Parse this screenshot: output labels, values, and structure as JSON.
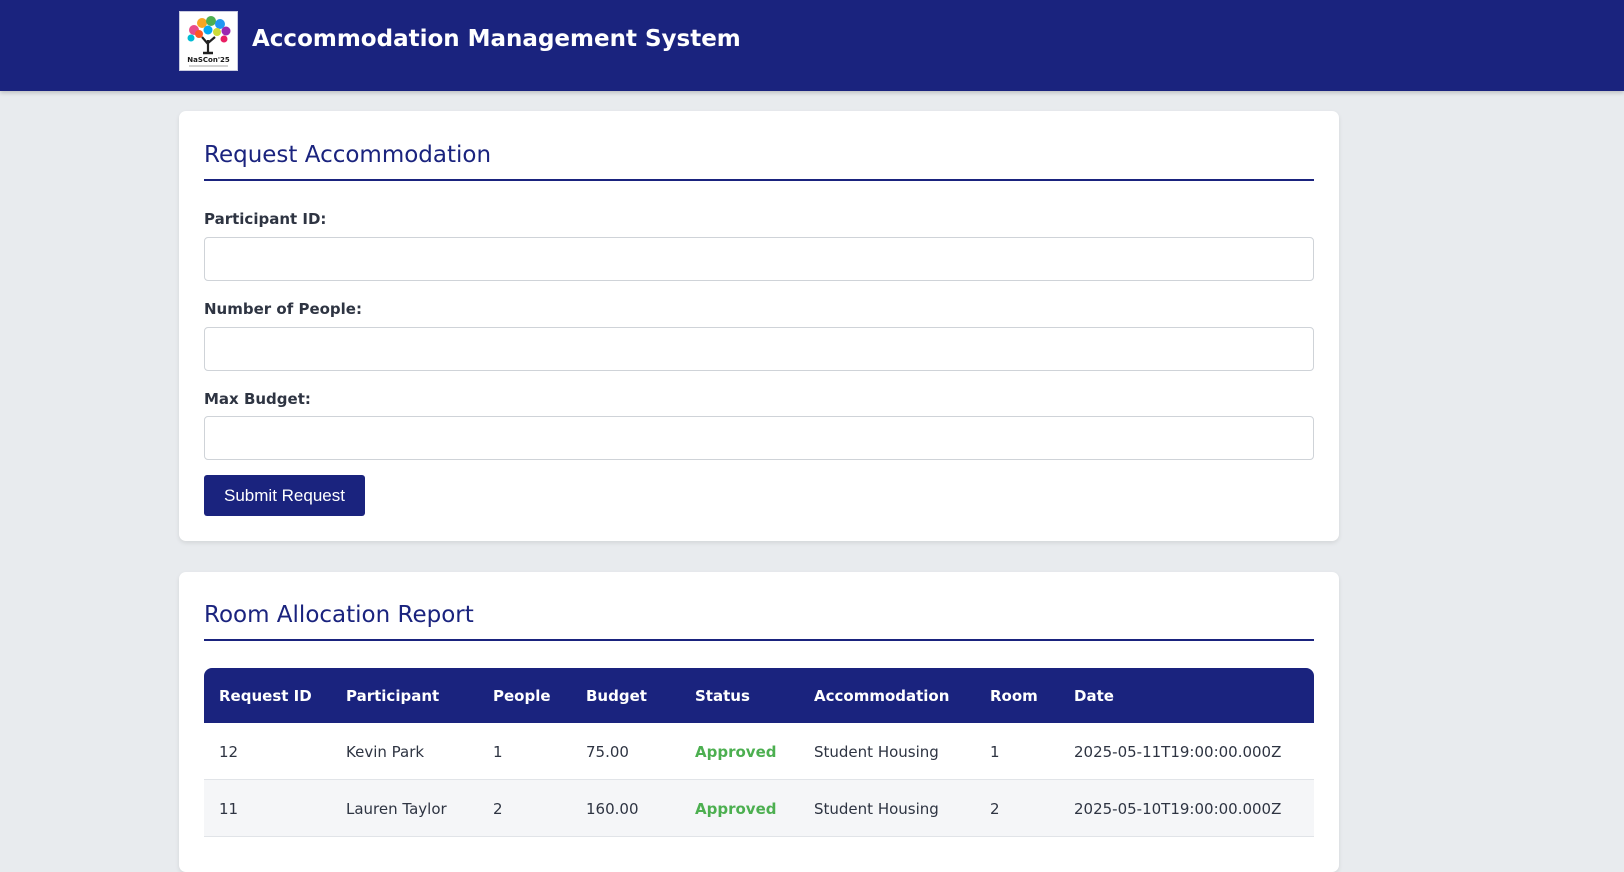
{
  "header": {
    "title": "Accommodation Management System",
    "logo_icon": "tree-logo-icon"
  },
  "request_form": {
    "title": "Request Accommodation",
    "fields": [
      {
        "label": "Participant ID:",
        "value": "",
        "placeholder": ""
      },
      {
        "label": "Number of People:",
        "value": "",
        "placeholder": ""
      },
      {
        "label": "Max Budget:",
        "value": "",
        "placeholder": ""
      }
    ],
    "submit_label": "Submit Request"
  },
  "report": {
    "title": "Room Allocation Report",
    "columns": [
      "Request ID",
      "Participant",
      "People",
      "Budget",
      "Status",
      "Accommodation",
      "Room",
      "Date"
    ],
    "rows": [
      [
        "12",
        "Kevin Park",
        "1",
        "75.00",
        "Approved",
        "Student Housing",
        "1",
        "2025-05-11T19:00:00.000Z"
      ],
      [
        "11",
        "Lauren Taylor",
        "2",
        "160.00",
        "Approved",
        "Student Housing",
        "2",
        "2025-05-10T19:00:00.000Z"
      ]
    ]
  },
  "colors": {
    "primary": "#1a237e",
    "background": "#e8ebee",
    "status_approved": "#4caf50"
  }
}
